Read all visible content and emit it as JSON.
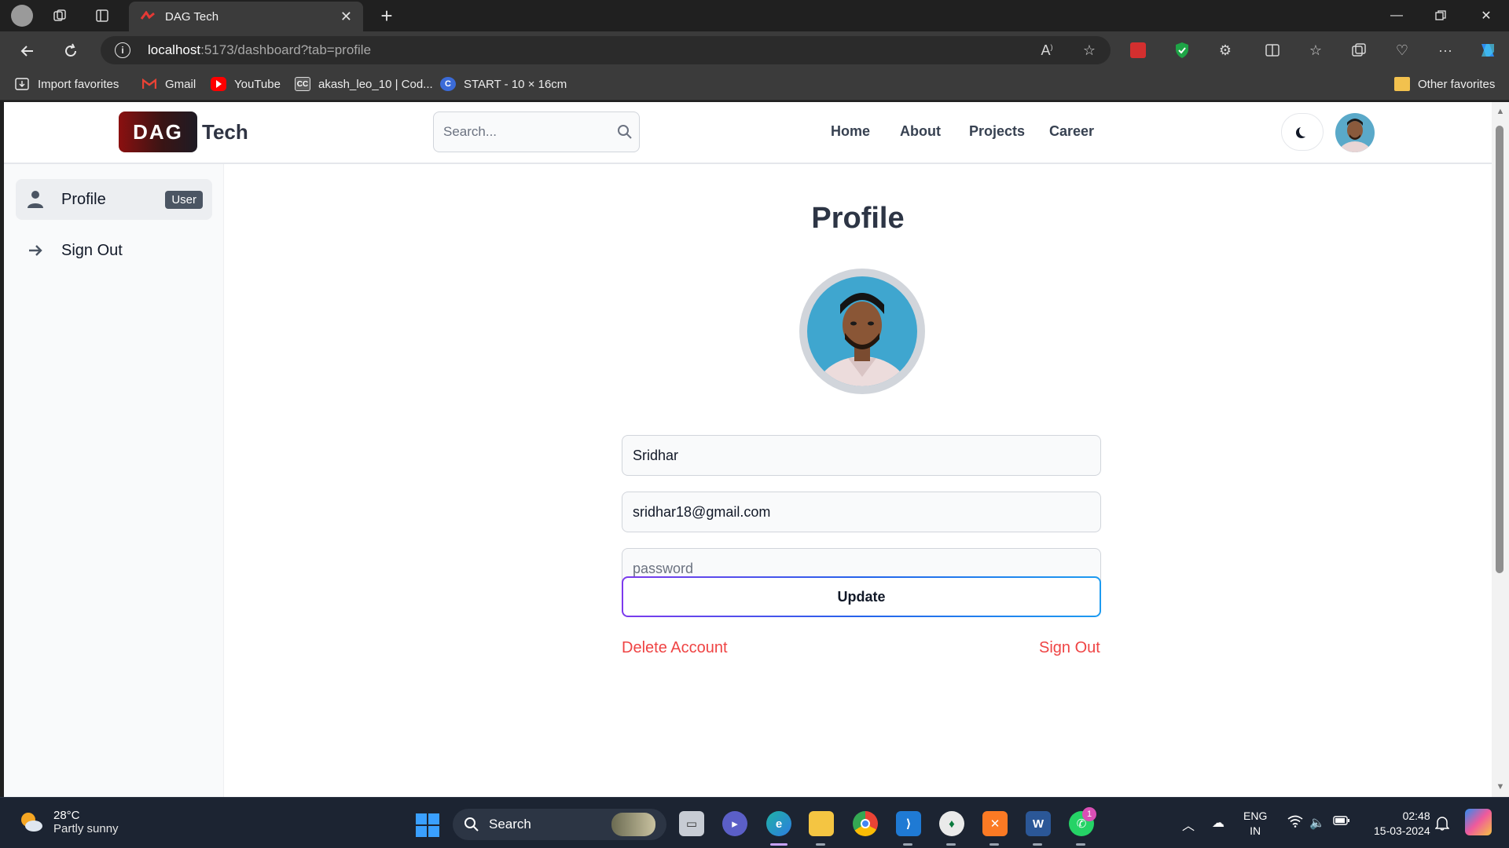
{
  "browser": {
    "tab_title": "DAG Tech",
    "url_host": "localhost",
    "url_rest": ":5173/dashboard?tab=profile",
    "favorites": [
      {
        "label": "Import favorites"
      },
      {
        "label": "Gmail"
      },
      {
        "label": "YouTube"
      },
      {
        "label": "akash_leo_10 | Cod..."
      },
      {
        "label": "START - 10 × 16cm"
      }
    ],
    "other_favorites": "Other favorites"
  },
  "header": {
    "logo_badge": "DAG",
    "logo_text": "Tech",
    "search_placeholder": "Search...",
    "nav": [
      "Home",
      "About",
      "Projects",
      "Career"
    ]
  },
  "sidebar": {
    "items": [
      {
        "label": "Profile",
        "badge": "User",
        "icon": "user-icon"
      },
      {
        "label": "Sign Out",
        "icon": "arrow-right-icon"
      }
    ]
  },
  "profile": {
    "title": "Profile",
    "username": "Sridhar",
    "email": "sridhar18@gmail.com",
    "password_placeholder": "password",
    "update_label": "Update",
    "delete_label": "Delete Account",
    "signout_label": "Sign Out"
  },
  "taskbar": {
    "temperature": "28°C",
    "weather": "Partly sunny",
    "search_label": "Search",
    "lang_top": "ENG",
    "lang_bottom": "IN",
    "time": "02:48",
    "date": "15-03-2024",
    "whatsapp_badge": "1"
  },
  "colors": {
    "danger": "#ef4444",
    "accent_gradient_start": "#7c3aed",
    "accent_gradient_end": "#1d9bf0"
  }
}
